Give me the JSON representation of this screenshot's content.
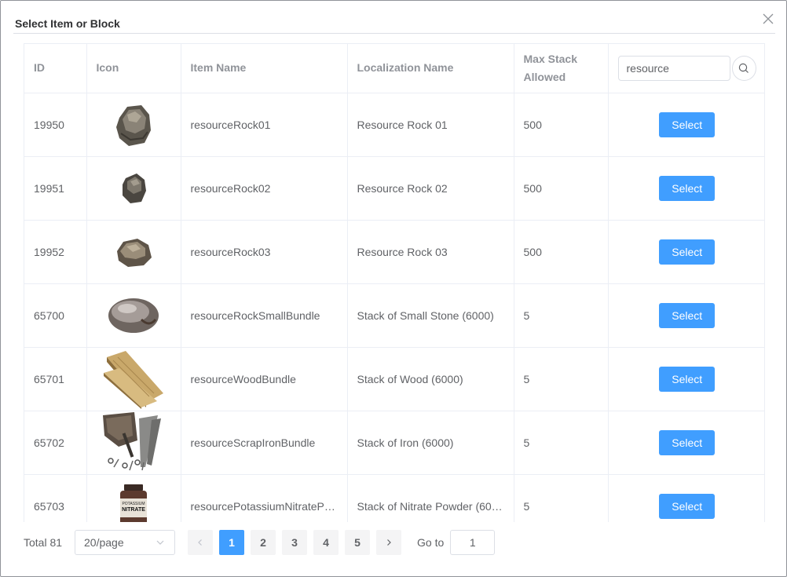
{
  "dialog": {
    "title": "Select Item or Block"
  },
  "table": {
    "columns": {
      "id": "ID",
      "icon": "Icon",
      "item_name": "Item Name",
      "localization": "Localization Name",
      "max_stack": "Max Stack Allowed"
    },
    "search": {
      "value": "resource"
    },
    "action_label": "Select",
    "rows": [
      {
        "id": "19950",
        "icon": "rock-icon",
        "item_name": "resourceRock01",
        "localization": "Resource Rock 01",
        "max_stack": "500"
      },
      {
        "id": "19951",
        "icon": "rock-icon",
        "item_name": "resourceRock02",
        "localization": "Resource Rock 02",
        "max_stack": "500"
      },
      {
        "id": "19952",
        "icon": "rock-icon",
        "item_name": "resourceRock03",
        "localization": "Resource Rock 03",
        "max_stack": "500"
      },
      {
        "id": "65700",
        "icon": "stone-icon",
        "item_name": "resourceRockSmallBundle",
        "localization": "Stack of Small Stone (6000)",
        "max_stack": "5"
      },
      {
        "id": "65701",
        "icon": "wood-planks-icon",
        "item_name": "resourceWoodBundle",
        "localization": "Stack of Wood (6000)",
        "max_stack": "5"
      },
      {
        "id": "65702",
        "icon": "iron-scrap-icon",
        "item_name": "resourceScrapIronBundle",
        "localization": "Stack of Iron (6000)",
        "max_stack": "5"
      },
      {
        "id": "65703",
        "icon": "nitrate-jar-icon",
        "item_name": "resourcePotassiumNitrateP…",
        "localization": "Stack of Nitrate Powder (60…",
        "max_stack": "5",
        "icon_text_1": "POTASSIUM",
        "icon_text_2": "NITRATE"
      }
    ]
  },
  "pagination": {
    "total": "Total 81",
    "page_size": "20/page",
    "pages": [
      "1",
      "2",
      "3",
      "4",
      "5"
    ],
    "current": "1",
    "goto_label": "Go to",
    "goto_value": "1"
  },
  "colors": {
    "primary": "#409eff",
    "border": "#ebeef5",
    "header_text": "#909399"
  }
}
